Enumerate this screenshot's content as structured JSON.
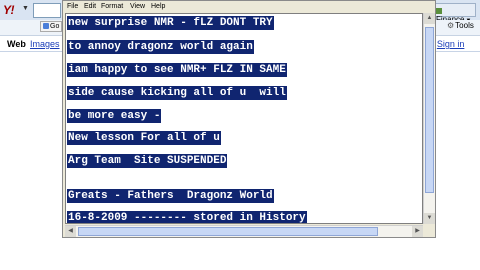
{
  "browser": {
    "logo": "Y!",
    "finance_label": "Finance",
    "go_label": "Go",
    "tools_label": "Tools",
    "tabs": [
      {
        "label": "Web"
      },
      {
        "label": "Images"
      }
    ],
    "sign_in_prefix": "| ",
    "sign_in_label": "Sign in"
  },
  "notepad": {
    "menu": [
      {
        "label": "File"
      },
      {
        "label": "Edit"
      },
      {
        "label": "Format"
      },
      {
        "label": "View"
      },
      {
        "label": "Help"
      }
    ],
    "lines": [
      "new surprise NMR - fLZ DONT TRY",
      "to annoy dragonz world again",
      "iam happy to see NMR+ FLZ IN SAME",
      "side cause kicking all of u  will",
      "be more easy -",
      "New lesson For all of u",
      "Arg Team  Site SUSPENDED",
      "Greats - Fathers  Dragonz World",
      "16-8-2009 -------- stored in History"
    ],
    "selection_color": "#102570"
  }
}
